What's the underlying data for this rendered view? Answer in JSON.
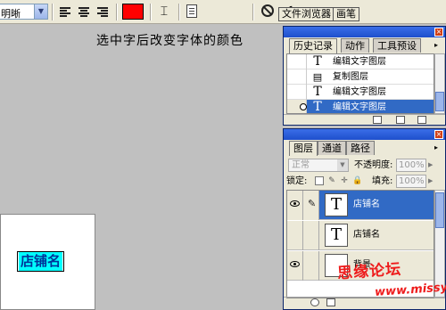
{
  "options_bar": {
    "font_style": "明晰",
    "text_color": "#ff0000",
    "icons": [
      "align-left-icon",
      "align-center-icon",
      "align-right-icon",
      "warp-text-icon",
      "palettes-icon",
      "cancel-icon",
      "commit-icon"
    ]
  },
  "palette_well": {
    "tabs": [
      "文件浏览器",
      "画笔"
    ]
  },
  "canvas": {
    "instruction": "选中字后改变字体的颜色",
    "doc_text": "店铺名",
    "highlight_color": "#00ffff"
  },
  "history_palette": {
    "tabs": [
      "历史记录",
      "动作",
      "工具预设"
    ],
    "items": [
      {
        "icon": "T",
        "label": "编辑文字图层",
        "selected": false
      },
      {
        "icon": "▤",
        "label": "复制图层",
        "selected": false
      },
      {
        "icon": "T",
        "label": "编辑文字图层",
        "selected": false
      },
      {
        "icon": "T",
        "label": "编辑文字图层",
        "selected": true
      }
    ]
  },
  "layers_palette": {
    "tabs": [
      "图层",
      "通道",
      "路径"
    ],
    "blend_mode": "正常",
    "opacity_label": "不透明度:",
    "opacity_value": "100%",
    "lock_label": "锁定:",
    "fill_label": "填充:",
    "fill_value": "100%",
    "layers": [
      {
        "name": "店铺名",
        "thumb": "T",
        "visible": true,
        "selected": true
      },
      {
        "name": "店铺名",
        "thumb": "T",
        "visible": false,
        "selected": false
      },
      {
        "name": "背景",
        "thumb": "",
        "visible": true,
        "selected": false
      }
    ]
  },
  "watermark": {
    "line1": "思缘论坛",
    "line2": "www.missyuan.com"
  }
}
